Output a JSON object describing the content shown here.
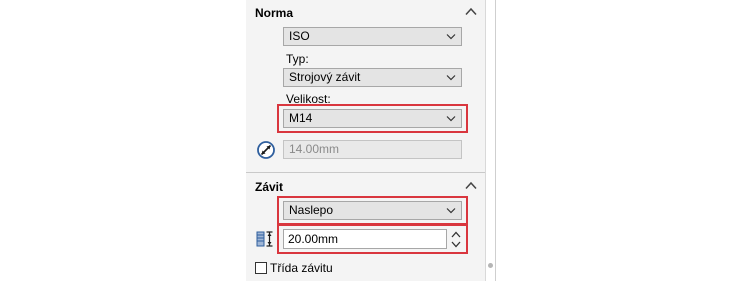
{
  "norma_section": {
    "title": "Norma",
    "standard": {
      "value": "ISO"
    },
    "type": {
      "label": "Typ:",
      "value": "Strojový závit"
    },
    "size": {
      "label": "Velikost:",
      "value": "M14"
    },
    "diameter": {
      "value": "14.00mm"
    }
  },
  "zavit_section": {
    "title": "Závit",
    "end_condition": {
      "value": "Naslepo"
    },
    "depth": {
      "value": "20.00mm"
    },
    "thread_class": {
      "label": "Třída závitu",
      "checked": false
    }
  },
  "icons": {
    "collapse": "chevron-up-icon",
    "dropdown": "chevron-down-icon",
    "diameter": "diameter-icon",
    "depth": "depth-icon"
  },
  "colors": {
    "highlight": "#d9363e",
    "panel_bg": "#f4f4f4",
    "icon_blue": "#2f5f9e"
  }
}
